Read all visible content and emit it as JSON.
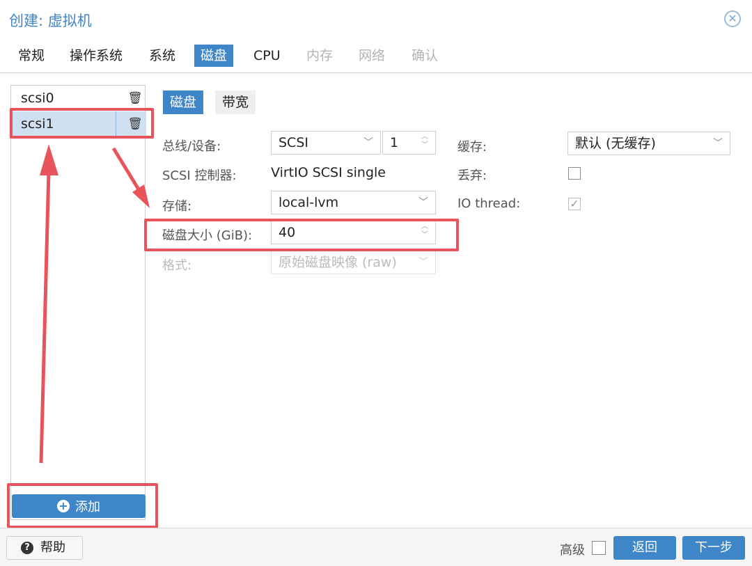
{
  "dialog": {
    "title": "创建: 虚拟机",
    "close_icon": "close-icon"
  },
  "tabs": [
    {
      "label": "常规",
      "state": "normal"
    },
    {
      "label": "操作系统",
      "state": "normal"
    },
    {
      "label": "系统",
      "state": "normal"
    },
    {
      "label": "磁盘",
      "state": "active"
    },
    {
      "label": "CPU",
      "state": "normal"
    },
    {
      "label": "内存",
      "state": "disabled"
    },
    {
      "label": "网络",
      "state": "disabled"
    },
    {
      "label": "确认",
      "state": "disabled"
    }
  ],
  "disks": [
    {
      "label": "scsi0",
      "selected": false
    },
    {
      "label": "scsi1",
      "selected": true
    }
  ],
  "add_button": {
    "label": "添加"
  },
  "subtabs": [
    {
      "label": "磁盘",
      "active": true
    },
    {
      "label": "带宽",
      "active": false
    }
  ],
  "form": {
    "bus_label": "总线/设备:",
    "bus_value": "SCSI",
    "device_value": "1",
    "controller_label": "SCSI 控制器:",
    "controller_value": "VirtIO SCSI single",
    "storage_label": "存储:",
    "storage_value": "local-lvm",
    "size_label": "磁盘大小 (GiB):",
    "size_value": "40",
    "format_label": "格式:",
    "format_value": "原始磁盘映像 (raw)",
    "cache_label": "缓存:",
    "cache_value": "默认 (无缓存)",
    "discard_label": "丢弃:",
    "discard_checked": false,
    "iothread_label": "IO thread:",
    "iothread_checked": true
  },
  "footer": {
    "help_label": "帮助",
    "advanced_label": "高级",
    "advanced_checked": false,
    "back_label": "返回",
    "next_label": "下一步"
  },
  "colors": {
    "accent": "#3f86c9",
    "annotation": "#e8545a"
  }
}
